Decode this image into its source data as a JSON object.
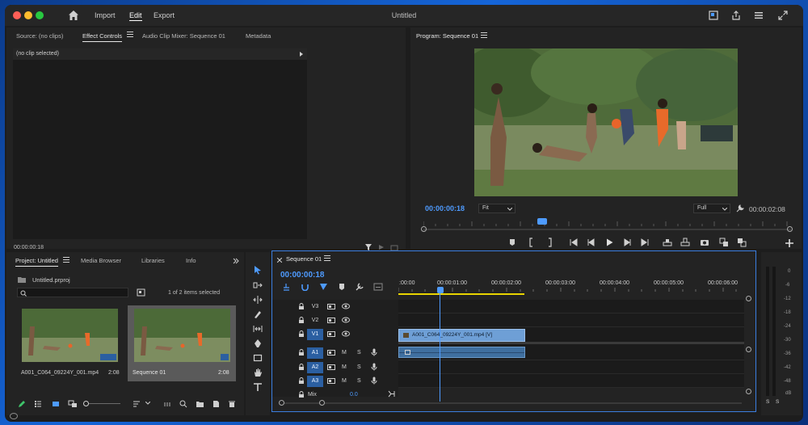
{
  "titlebar": {
    "menu": [
      "Import",
      "Edit",
      "Export"
    ],
    "active_menu": "Edit",
    "title": "Untitled"
  },
  "source_panel": {
    "tabs": [
      "Source: (no clips)",
      "Effect Controls",
      "Audio Clip Mixer: Sequence 01",
      "Metadata"
    ],
    "active_tab": "Effect Controls",
    "no_clip_text": "(no clip selected)",
    "timecode": "00:00:00:18"
  },
  "program_panel": {
    "title": "Program: Sequence 01",
    "current_time": "00:00:00:18",
    "fit_select": "Fit",
    "quality_select": "Full",
    "duration": "00:00:02:08"
  },
  "project_panel": {
    "tabs": [
      "Project: Untitled",
      "Media Browser",
      "Libraries",
      "Info"
    ],
    "active_tab": "Project: Untitled",
    "file_name": "Untitled.prproj",
    "selection_status": "1 of 2 items selected",
    "items": [
      {
        "name": "A001_C064_09224Y_001.mp4",
        "duration": "2:08"
      },
      {
        "name": "Sequence 01",
        "duration": "2:08"
      }
    ]
  },
  "timeline": {
    "tab_title": "Sequence 01",
    "timecode": "00:00:00:18",
    "ruler": [
      ":00:00",
      "00:00:01:00",
      "00:00:02:00",
      "00:00:03:00",
      "00:00:04:00",
      "00:00:05:00",
      "00:00:06:00"
    ],
    "video_tracks": [
      "V3",
      "V2",
      "V1"
    ],
    "audio_tracks": [
      "A1",
      "A2",
      "A3"
    ],
    "mix_label": "Mix",
    "mix_value": "0.0",
    "video_clip_label": "A001_C064_09224Y_001.mp4 [V]",
    "track_buttons": {
      "m": "M",
      "s": "S"
    }
  },
  "meter": {
    "scale": [
      "0",
      "-6",
      "-12",
      "-18",
      "-24",
      "-30",
      "-36",
      "-42",
      "-48",
      "dB"
    ],
    "solo": [
      "S",
      "S"
    ]
  },
  "colors": {
    "accent": "#4e9bff",
    "clip_video": "#6e9fd6",
    "clip_audio": "#3f6f9f",
    "playhead": "#4e9bff",
    "work_area": "#e8d400"
  }
}
